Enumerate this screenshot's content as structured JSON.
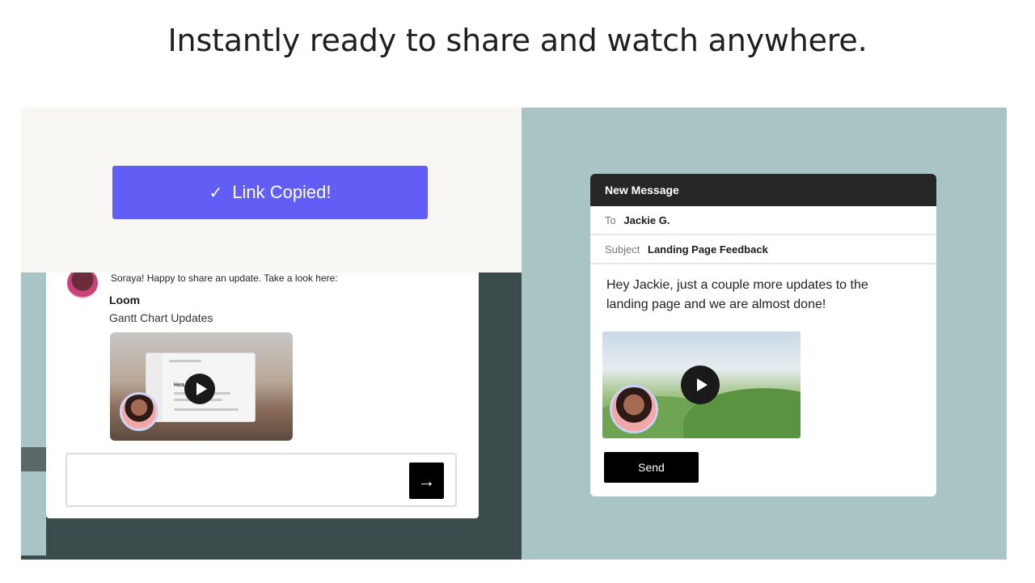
{
  "headline": "Instantly ready to share and watch anywhere.",
  "left": {
    "copied_button": {
      "label": "Link Copied!",
      "icon": "check-icon"
    },
    "chat": {
      "message": "Soraya! Happy to share an update. Take a look here:",
      "sender": "Loom",
      "link_title": "Gantt Chart Updates",
      "thumb_heading": "Hea"
    },
    "send_icon": "→"
  },
  "right": {
    "mail": {
      "title": "New Message",
      "to_label": "To",
      "to_value": "Jackie G.",
      "subject_label": "Subject",
      "subject_value": "Landing Page Feedback",
      "body": "Hey Jackie, just a couple more updates to the landing page and we are almost done!",
      "send_label": "Send"
    }
  },
  "colors": {
    "accent": "#625df5",
    "left_bg": "#3a4c4b",
    "right_bg": "#a8c4c4",
    "banner_bg": "#f7f6f2"
  }
}
